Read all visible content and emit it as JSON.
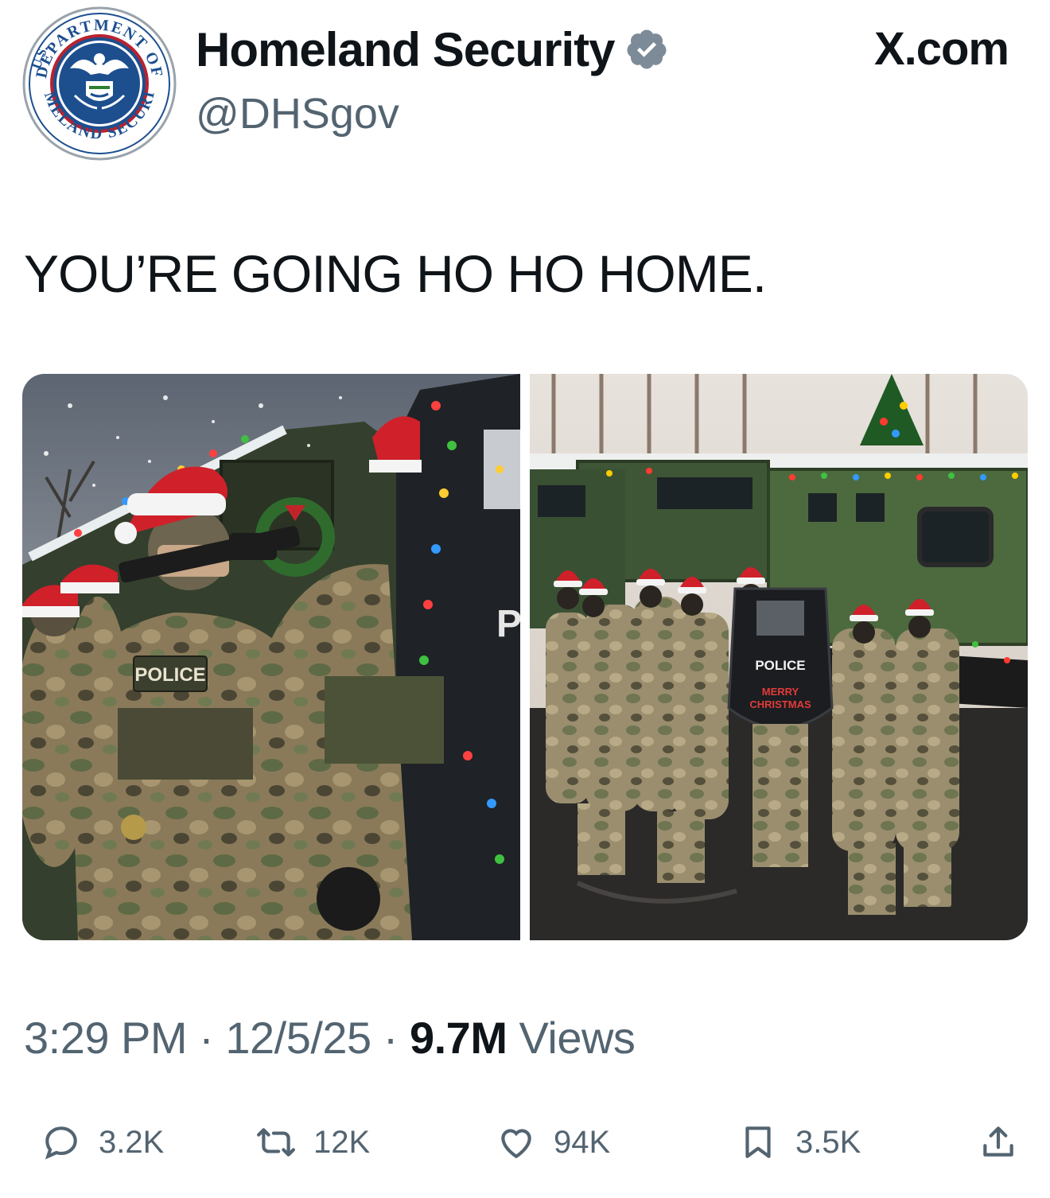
{
  "header": {
    "display_name": "Homeland Security",
    "handle": "@DHSgov",
    "brand": "X.com",
    "verified": true,
    "seal_text_top": "DEPARTMENT OF",
    "seal_text_left": "U.S.",
    "seal_text_bottom": "HOMELAND SECURITY"
  },
  "tweet": {
    "text": "YOU’RE GOING HO HO HOME."
  },
  "media": {
    "photos": [
      {
        "patch_label": "POLICE",
        "shield_letter": "P"
      },
      {
        "shield_label": "POLICE",
        "shield_greeting_1": "MERRY",
        "shield_greeting_2": "CHRISTMAS"
      }
    ]
  },
  "meta": {
    "time": "3:29 PM",
    "separator": "·",
    "date": "12/5/25",
    "views_count": "9.7M",
    "views_label": "Views"
  },
  "actions": {
    "replies": "3.2K",
    "reposts": "12K",
    "likes": "94K",
    "bookmarks": "3.5K"
  },
  "colors": {
    "text_primary": "#0f1419",
    "text_secondary": "#536471",
    "verified_badge": "#7d8b99",
    "seal_blue": "#1d4f8f"
  },
  "icons": [
    "reply-icon",
    "repost-icon",
    "like-icon",
    "bookmark-icon",
    "share-icon",
    "verified-badge-icon"
  ]
}
